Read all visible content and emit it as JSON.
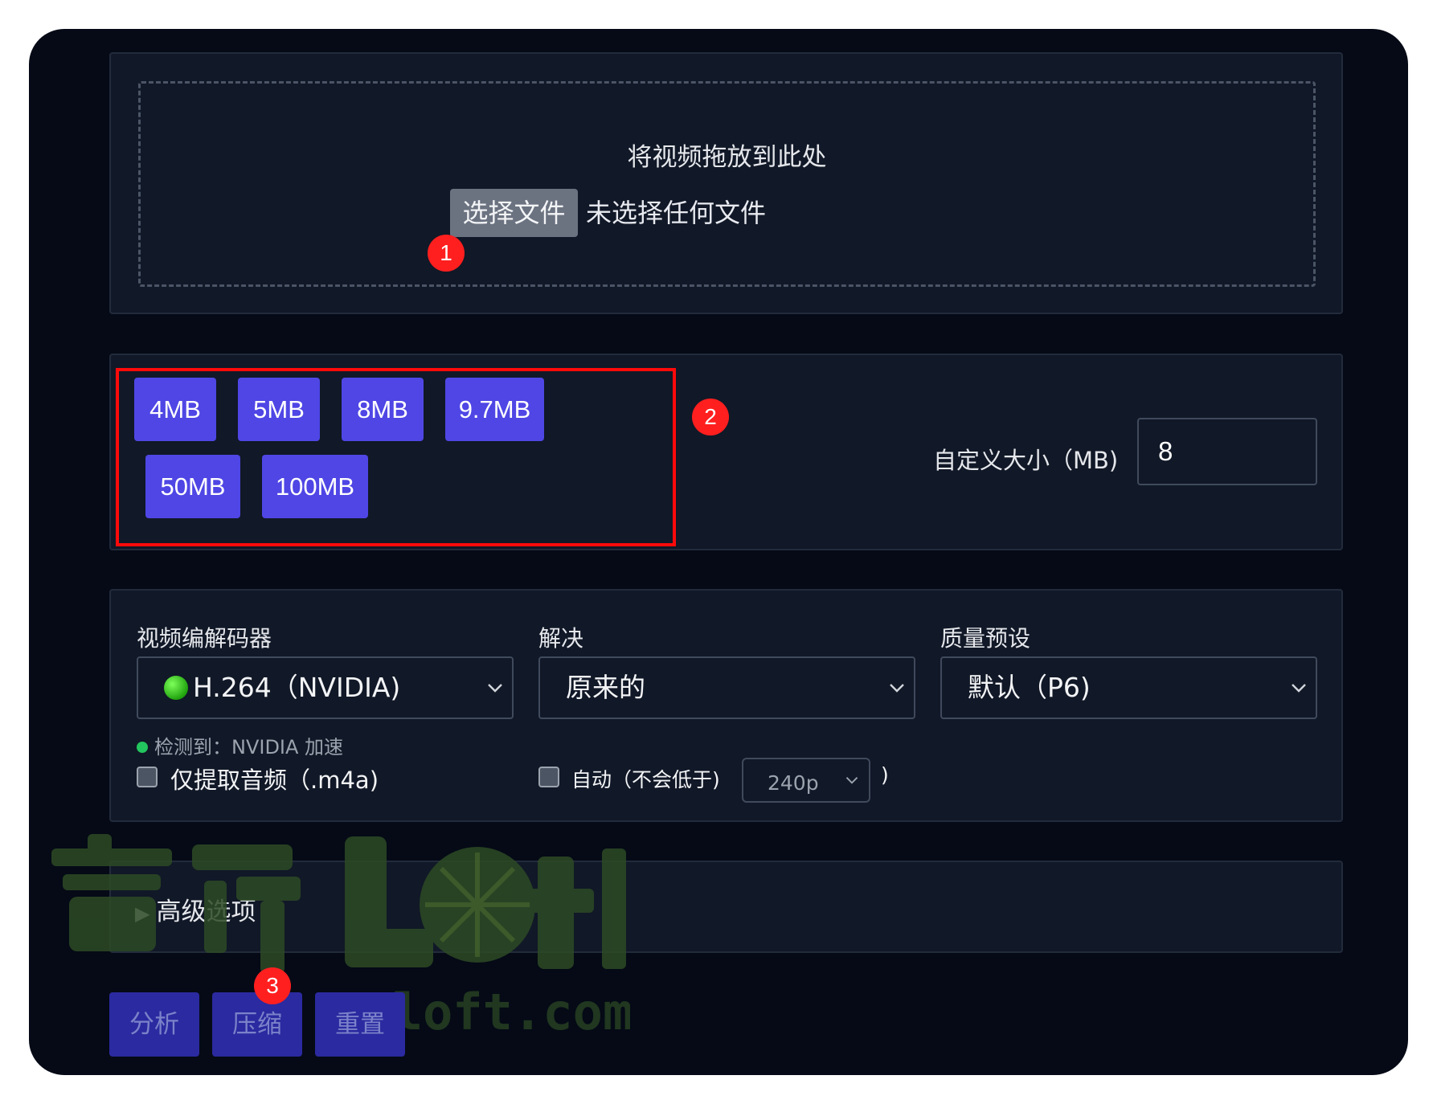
{
  "upload": {
    "drop_text": "将视频拖放到此处",
    "choose_button": "选择文件",
    "file_status": "未选择任何文件"
  },
  "markers": [
    "1",
    "2",
    "3"
  ],
  "sizes": {
    "presets": [
      "4MB",
      "5MB",
      "8MB",
      "9.7MB",
      "50MB",
      "100MB"
    ],
    "custom_label": "自定义大小（MB)",
    "custom_value": "8"
  },
  "codec": {
    "label": "视频编解码器",
    "selected": "H.264（NVIDIA)",
    "detected": "检测到：NVIDIA 加速",
    "audio_only": "仅提取音频（.m4a)"
  },
  "resolution": {
    "label": "解决",
    "selected": "原来的",
    "auto_label": "自动（不会低于)",
    "min_value": "240p",
    "close_paren": ")"
  },
  "preset": {
    "label": "质量预设",
    "selected": "默认（P6)"
  },
  "advanced": {
    "label": "高级选项"
  },
  "actions": {
    "analyze": "分析",
    "compress": "压缩",
    "reset": "重置"
  },
  "watermark": {
    "brand": "青柠Loft",
    "domain": "qnloft.com"
  },
  "colors": {
    "background": "#050a16",
    "panel": "#111827",
    "accent": "#4f46e5",
    "annotation": "#ff1f1f"
  }
}
